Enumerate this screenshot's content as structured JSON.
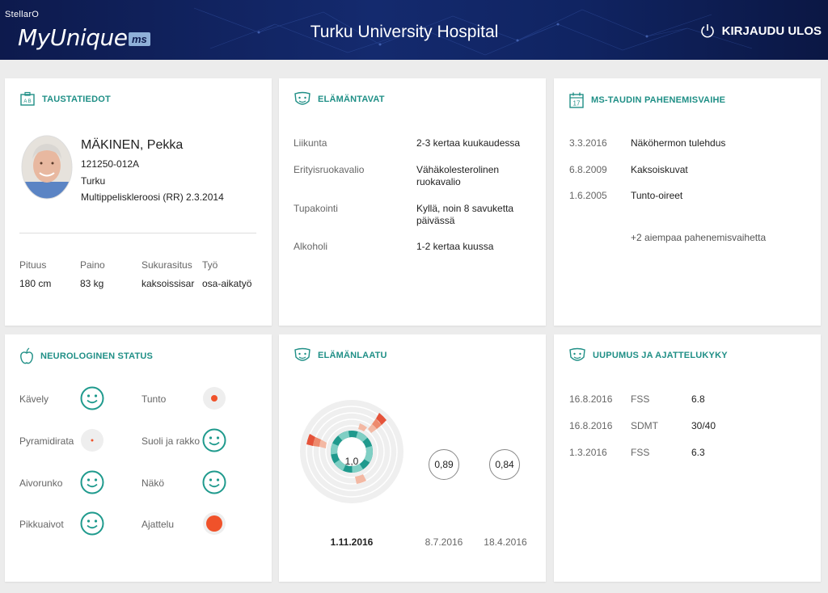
{
  "header": {
    "brand_small": "StellarO",
    "brand_name": "MyUnique",
    "brand_badge": "ms",
    "hospital": "Turku University Hospital",
    "logout_label": "KIRJAUDU ULOS"
  },
  "taustatiedot": {
    "title": "TAUSTATIEDOT",
    "name": "MÄKINEN, Pekka",
    "id": "121250-012A",
    "city": "Turku",
    "diagnosis": "Multippeliskleroosi (RR) 2.3.2014",
    "stats": [
      {
        "label": "Pituus",
        "value": "180 cm"
      },
      {
        "label": "Paino",
        "value": "83 kg"
      },
      {
        "label": "Sukurasitus",
        "value": "kaksoissisar"
      },
      {
        "label": "Työ",
        "value": "osa-aikatyö"
      }
    ]
  },
  "elamantavat": {
    "title": "ELÄMÄNTAVAT",
    "rows": [
      {
        "label": "Liikunta",
        "value": "2-3 kertaa kuukaudessa"
      },
      {
        "label": "Erityisruokavalio",
        "value": "Vähäkolesterolinen ruokavalio"
      },
      {
        "label": "Tupakointi",
        "value": "Kyllä, noin 8 savuketta päivässä"
      },
      {
        "label": "Alkoholi",
        "value": "1-2 kertaa kuussa"
      }
    ]
  },
  "pahenemisvaihe": {
    "title": "MS-TAUDIN PAHENEMISVAIHE",
    "rows": [
      {
        "date": "3.3.2016",
        "text": "Näköhermon tulehdus"
      },
      {
        "date": "6.8.2009",
        "text": "Kaksoiskuvat"
      },
      {
        "date": "1.6.2005",
        "text": "Tunto-oireet"
      }
    ],
    "more": "+2 aiempaa pahenemisvaihetta"
  },
  "neuro": {
    "title": "NEUROLOGINEN STATUS",
    "items": [
      {
        "label": "Kävely",
        "status": "smile"
      },
      {
        "label": "Tunto",
        "status": "minor"
      },
      {
        "label": "Pyramidirata",
        "status": "tiny"
      },
      {
        "label": "Suoli ja rakko",
        "status": "smile"
      },
      {
        "label": "Aivorunko",
        "status": "smile"
      },
      {
        "label": "Näkö",
        "status": "smile"
      },
      {
        "label": "Pikkuaivot",
        "status": "smile"
      },
      {
        "label": "Ajattelu",
        "status": "major"
      }
    ]
  },
  "elamanlaatu": {
    "title": "ELÄMÄNLAATU",
    "current_value": "1,0",
    "current_date": "1.11.2016",
    "history": [
      {
        "value": "0,89",
        "date": "8.7.2016"
      },
      {
        "value": "0,84",
        "date": "18.4.2016"
      }
    ]
  },
  "uupumus": {
    "title": "UUPUMUS JA AJATTELUKYKY",
    "rows": [
      {
        "date": "16.8.2016",
        "test": "FSS",
        "value": "6.8"
      },
      {
        "date": "16.8.2016",
        "test": "SDMT",
        "value": "30/40"
      },
      {
        "date": "1.3.2016",
        "test": "FSS",
        "value": "6.3"
      }
    ]
  },
  "colors": {
    "accent": "#1f8f86",
    "alert": "#f0522a",
    "alert_light": "#f3b8a3",
    "header": "#0f1f57"
  }
}
